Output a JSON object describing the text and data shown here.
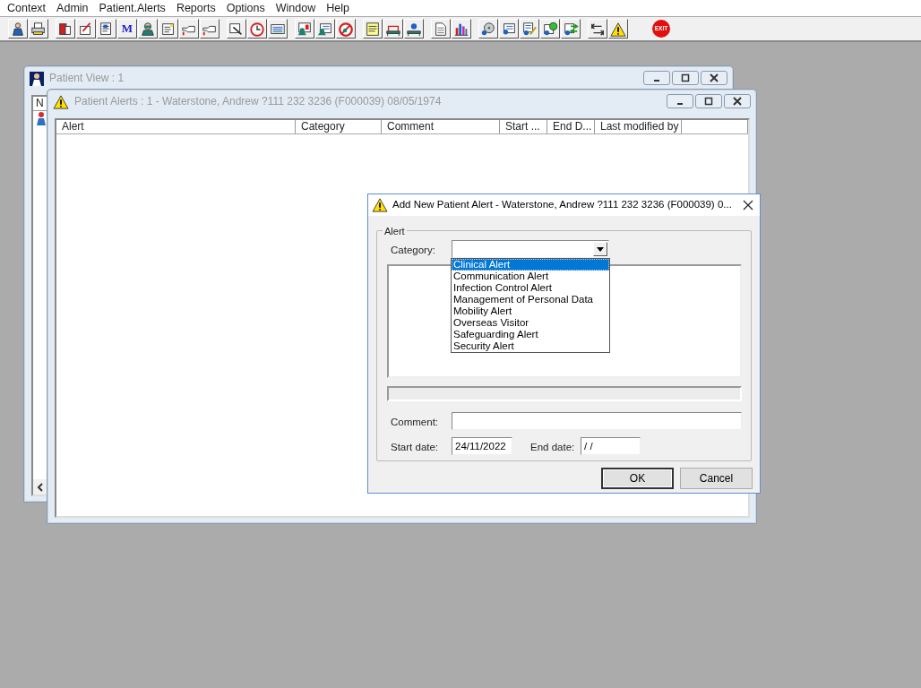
{
  "menu": [
    "Context",
    "Admin",
    "Patient.Alerts",
    "Reports",
    "Options",
    "Window",
    "Help"
  ],
  "toolbar": {
    "letter_button": "M",
    "exit_label": "EXIT"
  },
  "patient_view": {
    "title": "Patient View : 1",
    "active": false,
    "column_1": "N"
  },
  "patient_alerts": {
    "title": "Patient Alerts : 1 - Waterstone, Andrew ?111 232 3236 (F000039) 08/05/1974",
    "active": false,
    "columns": [
      "Alert",
      "Category",
      "Comment",
      "Start ...",
      "End D...",
      "Last modified by"
    ]
  },
  "dialog": {
    "title": "Add New Patient Alert - Waterstone, Andrew ?111 232 3236 (F000039) 0...",
    "active": true,
    "group_label": "Alert",
    "category": {
      "label": "Category:",
      "expanded": true,
      "options": [
        {
          "label": "Clinical Alert",
          "selected": true
        },
        {
          "label": "Communication Alert",
          "selected": false
        },
        {
          "label": "Infection Control Alert",
          "selected": false
        },
        {
          "label": "Management of Personal Data",
          "selected": false
        },
        {
          "label": "Mobility Alert",
          "selected": false
        },
        {
          "label": "Overseas Visitor",
          "selected": false
        },
        {
          "label": "Safeguarding Alert",
          "selected": false
        },
        {
          "label": "Security Alert",
          "selected": false
        }
      ]
    },
    "comment": {
      "label": "Comment:"
    },
    "start_date": {
      "label": "Start date:",
      "value": "24/11/2022"
    },
    "end_date": {
      "label": "End date:",
      "value": "/ /"
    },
    "buttons": [
      {
        "label": "OK",
        "default": true
      },
      {
        "label": "Cancel",
        "default": false
      }
    ]
  }
}
